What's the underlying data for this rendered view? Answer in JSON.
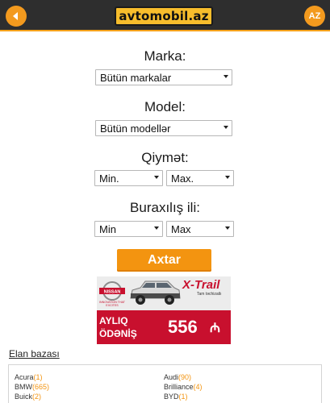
{
  "header": {
    "logo_text": "avtomobil.az",
    "lang_label": "AZ",
    "accent": "#f39a1e"
  },
  "form": {
    "marka": {
      "label": "Marka:",
      "value": "Bütün markalar"
    },
    "model": {
      "label": "Model:",
      "value": "Bütün modellər"
    },
    "price": {
      "label": "Qiymət:",
      "min": "Min.",
      "max": "Max."
    },
    "year": {
      "label": "Buraxılış ili:",
      "min": "Min",
      "max": "Max"
    },
    "search_label": "Axtar"
  },
  "ad": {
    "brand": "NISSAN",
    "brand_tagline": "INNOVATION THAT EXCITES",
    "model": "X-Trail",
    "tagline": "Tam təchizatlı",
    "line1": "AYLIQ",
    "line2": "ÖDƏNİŞ",
    "price": "556",
    "currency": "₼"
  },
  "elan": {
    "title": "Elan bazası",
    "items": [
      {
        "name": "Acura",
        "count": "(1)"
      },
      {
        "name": "Audi",
        "count": "(90)"
      },
      {
        "name": "BMW",
        "count": "(665)"
      },
      {
        "name": "Brilliance",
        "count": "(4)"
      },
      {
        "name": "Buick",
        "count": "(2)"
      },
      {
        "name": "BYD",
        "count": "(1)"
      }
    ]
  }
}
